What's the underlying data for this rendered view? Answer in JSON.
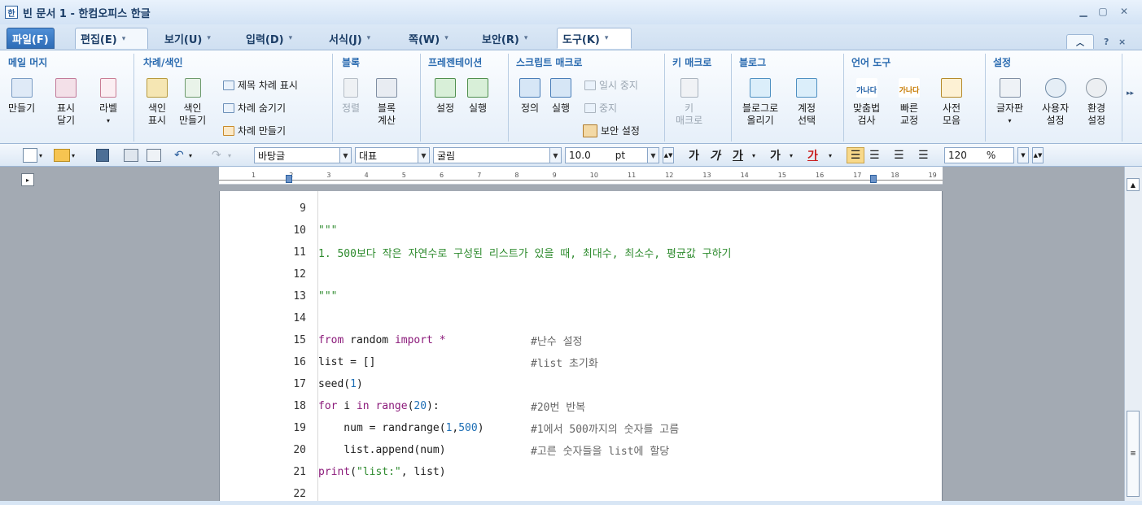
{
  "window": {
    "title": "빈 문서 1 - 한컴오피스 한글",
    "app_icon": "한"
  },
  "tabs": [
    "파일(F)",
    "편집(E)",
    "보기(U)",
    "입력(D)",
    "서식(J)",
    "쪽(W)",
    "보안(R)",
    "도구(K)"
  ],
  "right_tabs": {
    "help": "?",
    "close": "×"
  },
  "ribbon": {
    "groups": [
      "메일 머지",
      "차례/색인",
      "블록",
      "프레젠테이션",
      "스크립트 매크로",
      "키 매크로",
      "블로그",
      "언어 도구",
      "설정"
    ],
    "buttons": {
      "mail_make": "만들기",
      "mail_show": "표시",
      "mail_show2": "달기",
      "label": "라벨",
      "index_show": "색인",
      "index_show2": "표시",
      "index_make": "색인",
      "index_make2": "만들기",
      "toc_title": "제목 차례 표시",
      "toc_hide": "차례 숨기기",
      "toc_make": "차례 만들기",
      "block_sort": "정렬",
      "block_calc": "블록",
      "block_calc2": "계산",
      "pres_set": "설정",
      "pres_run": "실행",
      "script_def": "정의",
      "script_run": "실행",
      "script_pause": "일시 중지",
      "script_stop": "중지",
      "script_sec": "보안 설정",
      "key": "키",
      "key2": "매크로",
      "blog_post": "블로그로",
      "blog_post2": "올리기",
      "blog_acct": "계정",
      "blog_acct2": "선택",
      "spell": "맞춤법",
      "spell2": "검사",
      "quick": "빠른",
      "quick2": "교정",
      "dict": "사전",
      "dict2": "모음",
      "kbd": "글자판",
      "user": "사용자",
      "user2": "설정",
      "env": "환경",
      "env2": "설정",
      "icon_text": "가나다"
    }
  },
  "toolbar": {
    "style": "바탕글",
    "lang": "대표",
    "font": "굴림",
    "size": "10.0",
    "unit": "pt",
    "fmt": [
      "가",
      "가",
      "가",
      "가",
      "가"
    ],
    "zoom": "120",
    "zoom_unit": "%"
  },
  "ruler_numbers": [
    "1",
    "2",
    "3",
    "4",
    "5",
    "6",
    "7",
    "8",
    "9",
    "10",
    "11",
    "12",
    "13",
    "14",
    "15",
    "16",
    "17",
    "18",
    "19"
  ],
  "code_lines": [
    {
      "n": "9",
      "t": ""
    },
    {
      "n": "10",
      "t": "\"\"\""
    },
    {
      "n": "11",
      "t": "1. 500보다 작은 자연수로 구성된 리스트가 있을 때, 최대수, 최소수, 평균값 구하기"
    },
    {
      "n": "12",
      "t": ""
    },
    {
      "n": "13",
      "t": "\"\"\""
    },
    {
      "n": "14",
      "t": ""
    },
    {
      "n": "15",
      "t": "from random import *           #난수 설정"
    },
    {
      "n": "16",
      "t": "list = []                      #list 초기화"
    },
    {
      "n": "17",
      "t": "seed(1)"
    },
    {
      "n": "18",
      "t": "for i in range(20):            #20번 반복"
    },
    {
      "n": "19",
      "t": "    num = randrange(1,500)     #1에서 500까지의 숫자를 고름"
    },
    {
      "n": "20",
      "t": "    list.append(num)           #고른 숫자들을 list에 할당"
    },
    {
      "n": "21",
      "t": "print(\"list:\", list)"
    },
    {
      "n": "22",
      "t": ""
    }
  ],
  "code_parts": {
    "l15": {
      "kw1": "from",
      "a": " random ",
      "kw2": "import",
      "b": " *",
      "c": "#난수 설정"
    },
    "l16": {
      "a": "list = []",
      "c": "#list 초기화"
    },
    "l17": {
      "a": "seed(",
      "n": "1",
      "b": ")"
    },
    "l18": {
      "kw1": "for",
      "a": " i ",
      "kw2": "in",
      "b": " ",
      "kw3": "range",
      "c1": "(",
      "n": "20",
      "d": "):",
      "c": "#20번 반복"
    },
    "l19": {
      "a": "    num = ",
      "kw": "randrange",
      "b": "(",
      "n1": "1",
      "comma": ",",
      "n2": "500",
      "d": ")",
      "c": "#1에서 500까지의 숫자를 고름"
    },
    "l20": {
      "a": "    list.append(num)",
      "c": "#고른 숫자들을 list에 할당"
    },
    "l21": {
      "kw": "print",
      "a": "(",
      "s": "\"list:\"",
      "b": ", list)"
    }
  }
}
